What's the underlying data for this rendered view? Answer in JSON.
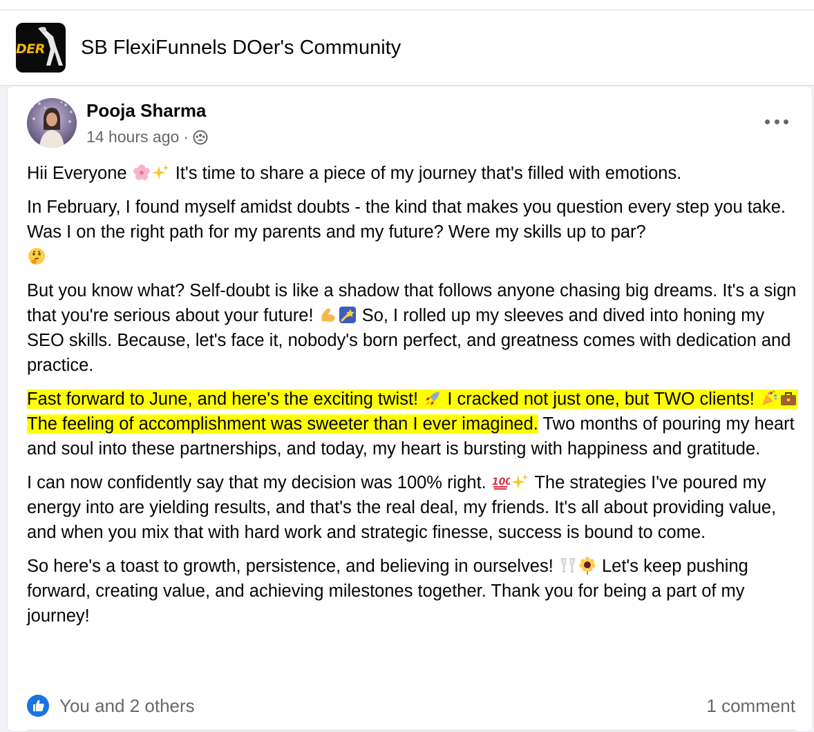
{
  "group": {
    "name": "SB FlexiFunnels DOer's Community",
    "logo_text": "DER"
  },
  "post": {
    "author": "Pooja Sharma",
    "time": "14 hours ago",
    "separator": "·",
    "audience_icon": "group-audience-icon",
    "p1": {
      "a": "Hii Everyone ",
      "b": " It's time to share a piece of my journey that's filled with emotions."
    },
    "p2": {
      "a": "In February, I found myself amidst doubts - the kind that makes you question every step you take. Was I on the right path for my parents and my future? Were my skills up to par?"
    },
    "p3": {
      "a": "But you know what? Self-doubt is like a shadow that follows anyone chasing big dreams. It's a sign that you're serious about your future! ",
      "b": " So, I rolled up my sleeves and dived into honing my SEO skills. Because, let's face it, nobody's born perfect, and greatness comes with dedication and practice."
    },
    "p4": {
      "hl_a": "Fast forward to June, and here's the exciting twist! ",
      "hl_b": " I cracked not just one, but TWO clients! ",
      "hl_c": " The feeling of accomplishment was sweeter than I ever imagined.",
      "rest": " Two months of pouring my heart and soul into these partnerships, and today, my heart is bursting with happiness and gratitude."
    },
    "p5": {
      "a": "I can now confidently say that my decision was 100% right. ",
      "b": " The strategies I've poured my energy into are yielding results, and that's the real deal, my friends. It's all about providing value, and when you mix that with hard work and strategic finesse, success is bound to come."
    },
    "p6": {
      "a": "So here's a toast to growth, persistence, and believing in ourselves! ",
      "b": " Let's keep pushing forward, creating value, and achieving milestones together. Thank you for being a part of my journey!"
    },
    "likes": "You and 2 others",
    "comments": "1 comment",
    "highlight_color": "#ffff00"
  },
  "colors": {
    "like_blue": "#1b74e4",
    "secondary_text": "#65676b"
  }
}
